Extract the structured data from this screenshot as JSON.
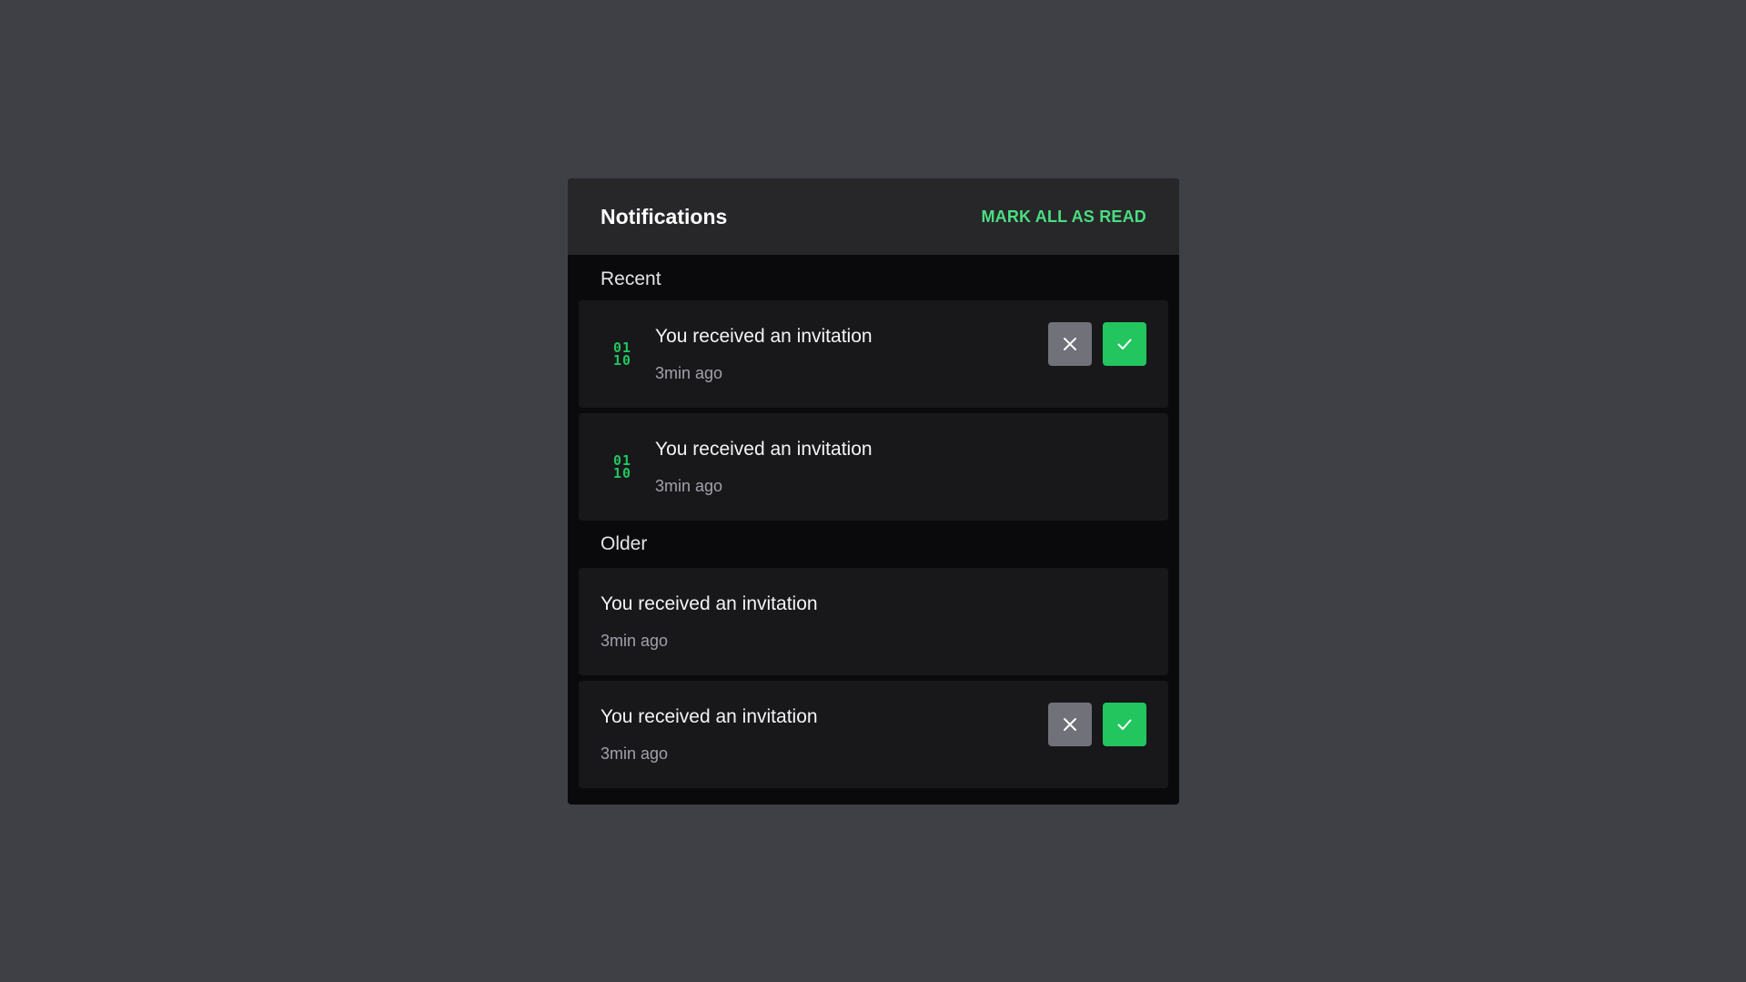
{
  "header": {
    "title": "Notifications",
    "mark_all_label": "MARK ALL AS READ"
  },
  "sections": {
    "recent": {
      "label": "Recent",
      "items": [
        {
          "icon": "binary-icon",
          "icon_text_top": "01",
          "icon_text_bottom": "10",
          "message": "You received an invitation",
          "time": "3min ago",
          "has_actions": true
        },
        {
          "icon": "binary-icon",
          "icon_text_top": "01",
          "icon_text_bottom": "10",
          "message": "You received an invitation",
          "time": "3min ago",
          "has_actions": false
        }
      ]
    },
    "older": {
      "label": "Older",
      "items": [
        {
          "message": "You received an invitation",
          "time": "3min ago",
          "has_actions": false
        },
        {
          "message": "You received an invitation",
          "time": "3min ago",
          "has_actions": true
        }
      ]
    }
  },
  "actions": {
    "decline_icon": "close-icon",
    "accept_icon": "check-icon"
  },
  "colors": {
    "background": "#3f4045",
    "panel": "#0a0a0c",
    "header": "#27272a",
    "card": "#18181b",
    "accent": "#22c55e",
    "link": "#4ade80",
    "decline_button": "#71717a"
  }
}
